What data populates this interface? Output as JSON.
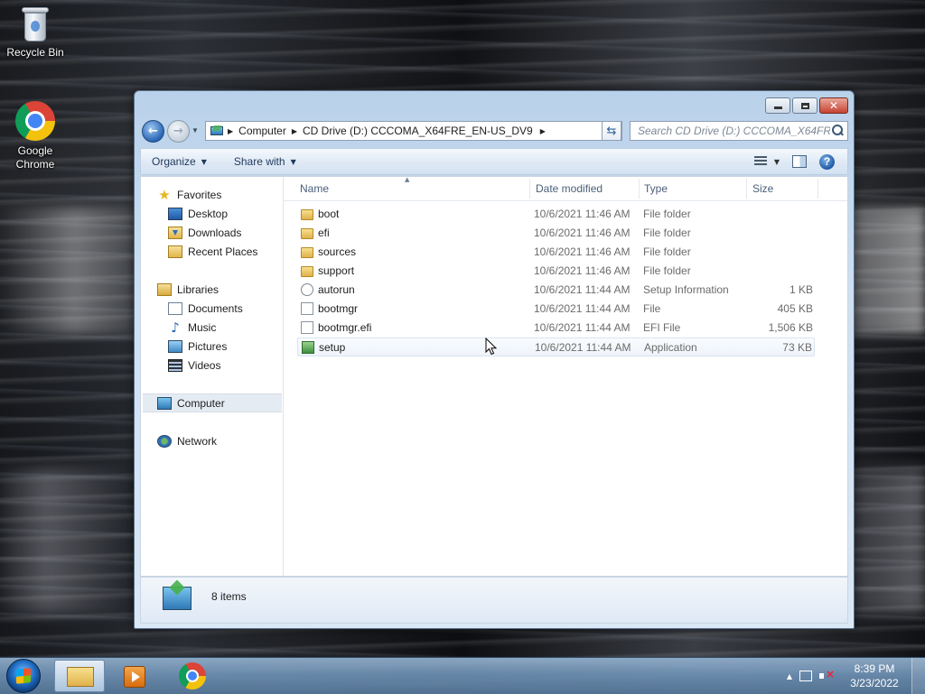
{
  "desktop": {
    "icons": [
      {
        "label": "Recycle Bin",
        "icon": "recycle-bin-icon"
      },
      {
        "label": "Google\nChrome",
        "icon": "chrome-icon"
      }
    ]
  },
  "window": {
    "address": {
      "crumbs": [
        "Computer",
        "CD Drive (D:) CCCOMA_X64FRE_EN-US_DV9"
      ]
    },
    "search": {
      "placeholder": "Search CD Drive (D:) CCCOMA_X64FR..."
    },
    "toolbar": {
      "organize": "Organize",
      "share_with": "Share with"
    },
    "nav": {
      "favorites": "Favorites",
      "desktop": "Desktop",
      "downloads": "Downloads",
      "recent_places": "Recent Places",
      "libraries": "Libraries",
      "documents": "Documents",
      "music": "Music",
      "pictures": "Pictures",
      "videos": "Videos",
      "computer": "Computer",
      "network": "Network"
    },
    "columns": {
      "name": "Name",
      "date_modified": "Date modified",
      "type": "Type",
      "size": "Size"
    },
    "files": [
      {
        "name": "boot",
        "date": "10/6/2021 11:46 AM",
        "type": "File folder",
        "size": "",
        "icon": "folder-icon"
      },
      {
        "name": "efi",
        "date": "10/6/2021 11:46 AM",
        "type": "File folder",
        "size": "",
        "icon": "folder-icon"
      },
      {
        "name": "sources",
        "date": "10/6/2021 11:46 AM",
        "type": "File folder",
        "size": "",
        "icon": "folder-icon"
      },
      {
        "name": "support",
        "date": "10/6/2021 11:46 AM",
        "type": "File folder",
        "size": "",
        "icon": "folder-icon"
      },
      {
        "name": "autorun",
        "date": "10/6/2021 11:44 AM",
        "type": "Setup Information",
        "size": "1 KB",
        "icon": "setup-information-icon"
      },
      {
        "name": "bootmgr",
        "date": "10/6/2021 11:44 AM",
        "type": "File",
        "size": "405 KB",
        "icon": "file-icon"
      },
      {
        "name": "bootmgr.efi",
        "date": "10/6/2021 11:44 AM",
        "type": "EFI File",
        "size": "1,506 KB",
        "icon": "file-icon"
      },
      {
        "name": "setup",
        "date": "10/6/2021 11:44 AM",
        "type": "Application",
        "size": "73 KB",
        "icon": "application-icon"
      }
    ],
    "status": {
      "items": "8 items"
    }
  },
  "taskbar": {
    "clock_time": "8:39 PM",
    "clock_date": "3/23/2022"
  }
}
